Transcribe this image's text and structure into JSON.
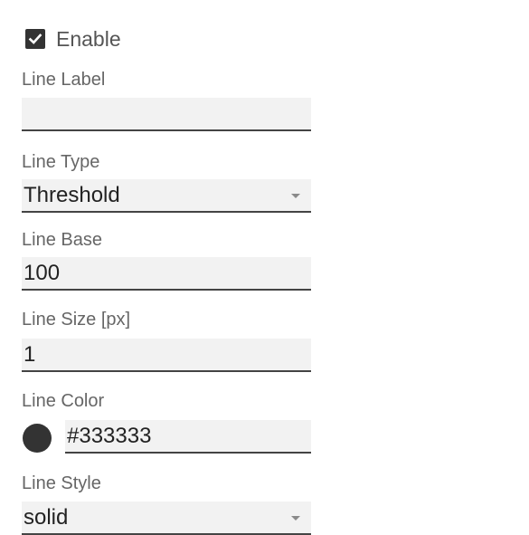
{
  "enable": {
    "label": "Enable",
    "checked": true
  },
  "line_label": {
    "label": "Line Label",
    "value": ""
  },
  "line_type": {
    "label": "Line Type",
    "value": "Threshold"
  },
  "line_base": {
    "label": "Line Base",
    "value": "100"
  },
  "line_size": {
    "label": "Line Size [px]",
    "value": "1"
  },
  "line_color": {
    "label": "Line Color",
    "value": "#333333",
    "swatch_color": "#333333"
  },
  "line_style": {
    "label": "Line Style",
    "value": "solid"
  },
  "icons": {
    "checkbox": "checkmark-icon",
    "dropdown": "chevron-down-icon"
  }
}
